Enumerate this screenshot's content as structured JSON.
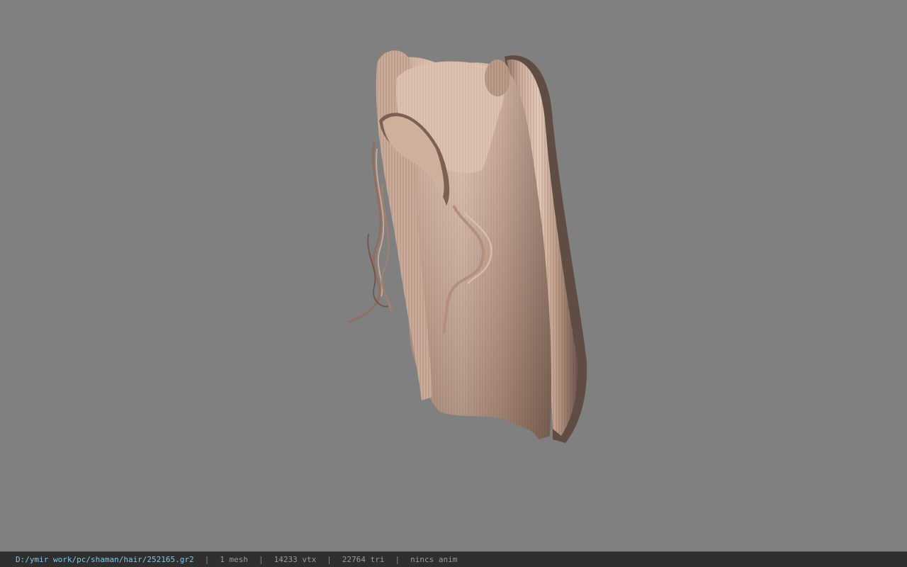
{
  "viewport": {
    "background_color": "#808080",
    "model": "hair-mesh"
  },
  "status_bar": {
    "file_path": "D:/ymir work/pc/shaman/hair/252165.gr2",
    "separator": "|",
    "mesh_count": "1 mesh",
    "vertex_count": "14233 vtx",
    "triangle_count": "22764 tri",
    "anim_status": "nincs anim",
    "path_color": "#7fc6e8",
    "background_color": "#2f2f2f"
  }
}
